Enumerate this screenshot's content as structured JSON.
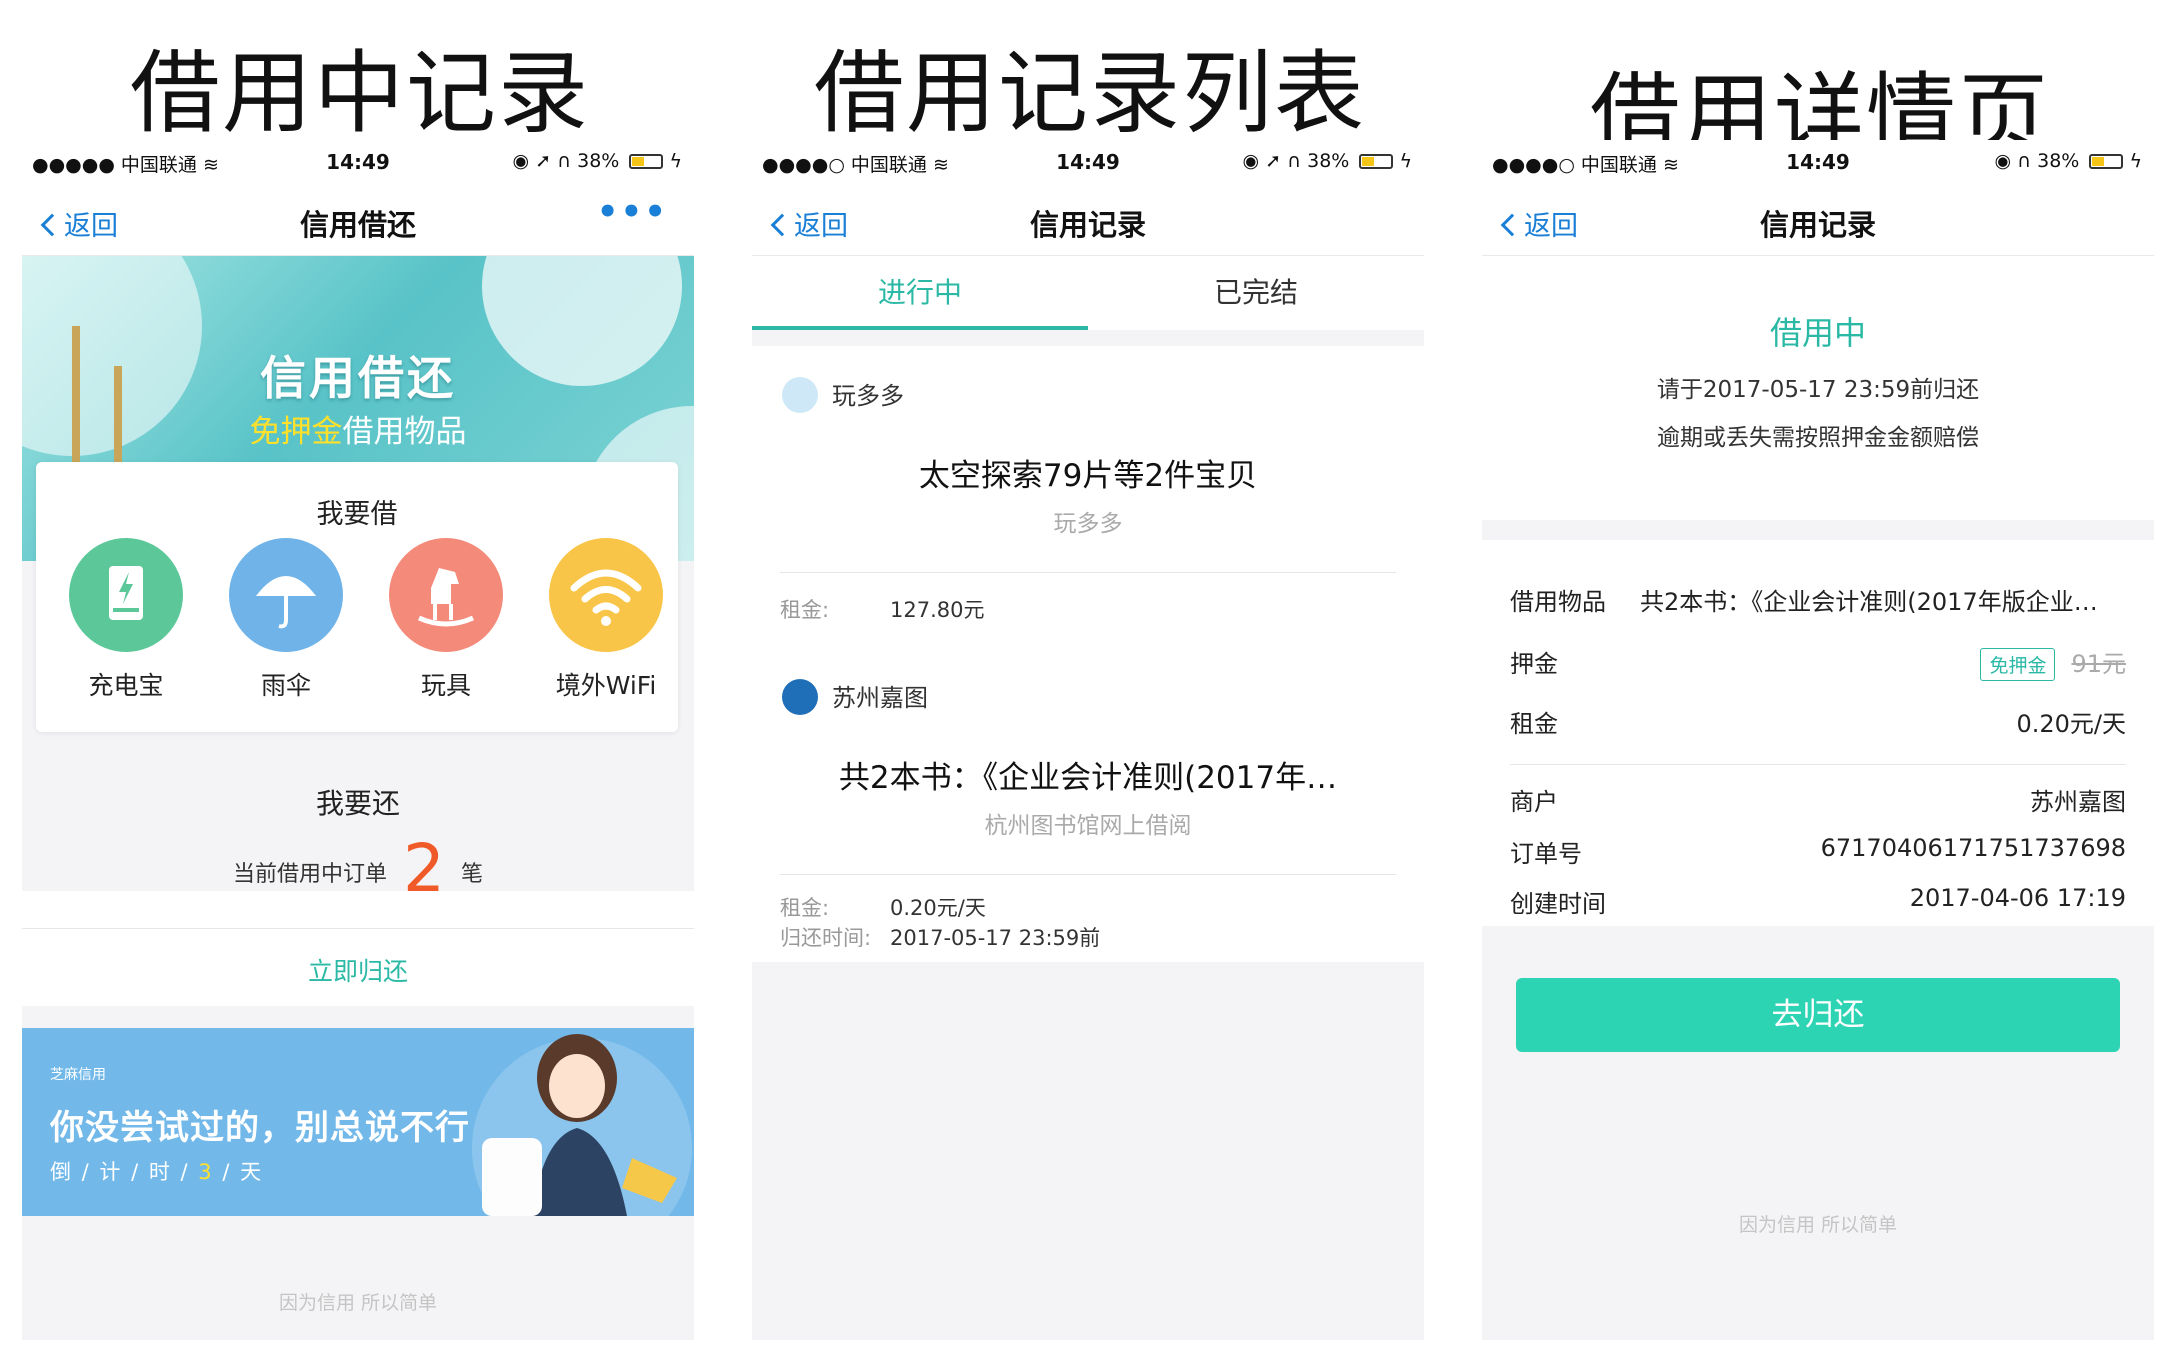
{
  "captions": {
    "c1": "借用中记录",
    "c2": "借用记录列表",
    "c3": "借用详情页"
  },
  "status_bar": {
    "p1": {
      "carrier": "●●●●● 中国联通",
      "time": "14:49",
      "battery": "38%"
    },
    "p2": {
      "carrier": "●●●●○ 中国联通",
      "time": "14:49",
      "battery": "38%"
    },
    "p3": {
      "carrier": "●●●●○ 中国联通",
      "time": "14:49",
      "battery": "38%"
    },
    "battery_level": 0.38
  },
  "phone1": {
    "back_label": "返回",
    "title": "信用借还",
    "more": "•••",
    "banner": {
      "title": "信用借还",
      "sub_highlight": "免押金",
      "sub_rest": "借用物品"
    },
    "borrow": {
      "heading": "我要借",
      "categories": [
        {
          "label": "充电宝",
          "icon": "power-bank-icon",
          "color": "#5cc89a"
        },
        {
          "label": "雨伞",
          "icon": "umbrella-icon",
          "color": "#6fb3e8"
        },
        {
          "label": "玩具",
          "icon": "toy-horse-icon",
          "color": "#f48a7a"
        },
        {
          "label": "境外WiFi",
          "icon": "wifi-icon",
          "color": "#f9c548"
        }
      ]
    },
    "return": {
      "heading": "我要还",
      "prefix": "当前借用中订单",
      "count": "2",
      "suffix": "笔",
      "link": "立即归还"
    },
    "promo": {
      "brand": "芝麻信用",
      "slogan": "你没尝试过的，别总说不行",
      "countdown_pre": "倒 / 计 / 时 / ",
      "countdown_num": "3",
      "countdown_post": " / 天"
    },
    "footer": "因为信用  所以简单"
  },
  "phone2": {
    "back_label": "返回",
    "title": "信用记录",
    "tabs": [
      "进行中",
      "已完结"
    ],
    "orders": [
      {
        "shop": "玩多多",
        "item": "太空探索79片等2件宝贝",
        "source": "玩多多",
        "rent_label": "租金:",
        "rent": "127.80元"
      },
      {
        "shop": "苏州嘉图",
        "item": "共2本书：《企业会计准则(2017年…",
        "source": "杭州图书馆网上借阅",
        "rent_label": "租金:",
        "rent": "0.20元/天",
        "due_label": "归还时间:",
        "due": "2017-05-17 23:59前"
      }
    ]
  },
  "phone3": {
    "back_label": "返回",
    "title": "信用记录",
    "state": "借用中",
    "line1": "请于2017-05-17 23:59前归还",
    "line2": "逾期或丢失需按照押金金额赔偿",
    "rows": {
      "item_k": "借用物品",
      "item_v": "共2本书：《企业会计准则(2017年版企业…",
      "deposit_k": "押金",
      "deposit_tag": "免押金",
      "deposit_v": "91元",
      "rent_k": "租金",
      "rent_v": "0.20元/天",
      "merchant_k": "商户",
      "merchant_v": "苏州嘉图",
      "order_k": "订单号",
      "order_v": "67170406171751737698",
      "created_k": "创建时间",
      "created_v": "2017-04-06 17:19"
    },
    "button": "去归还",
    "footer": "因为信用  所以简单"
  }
}
